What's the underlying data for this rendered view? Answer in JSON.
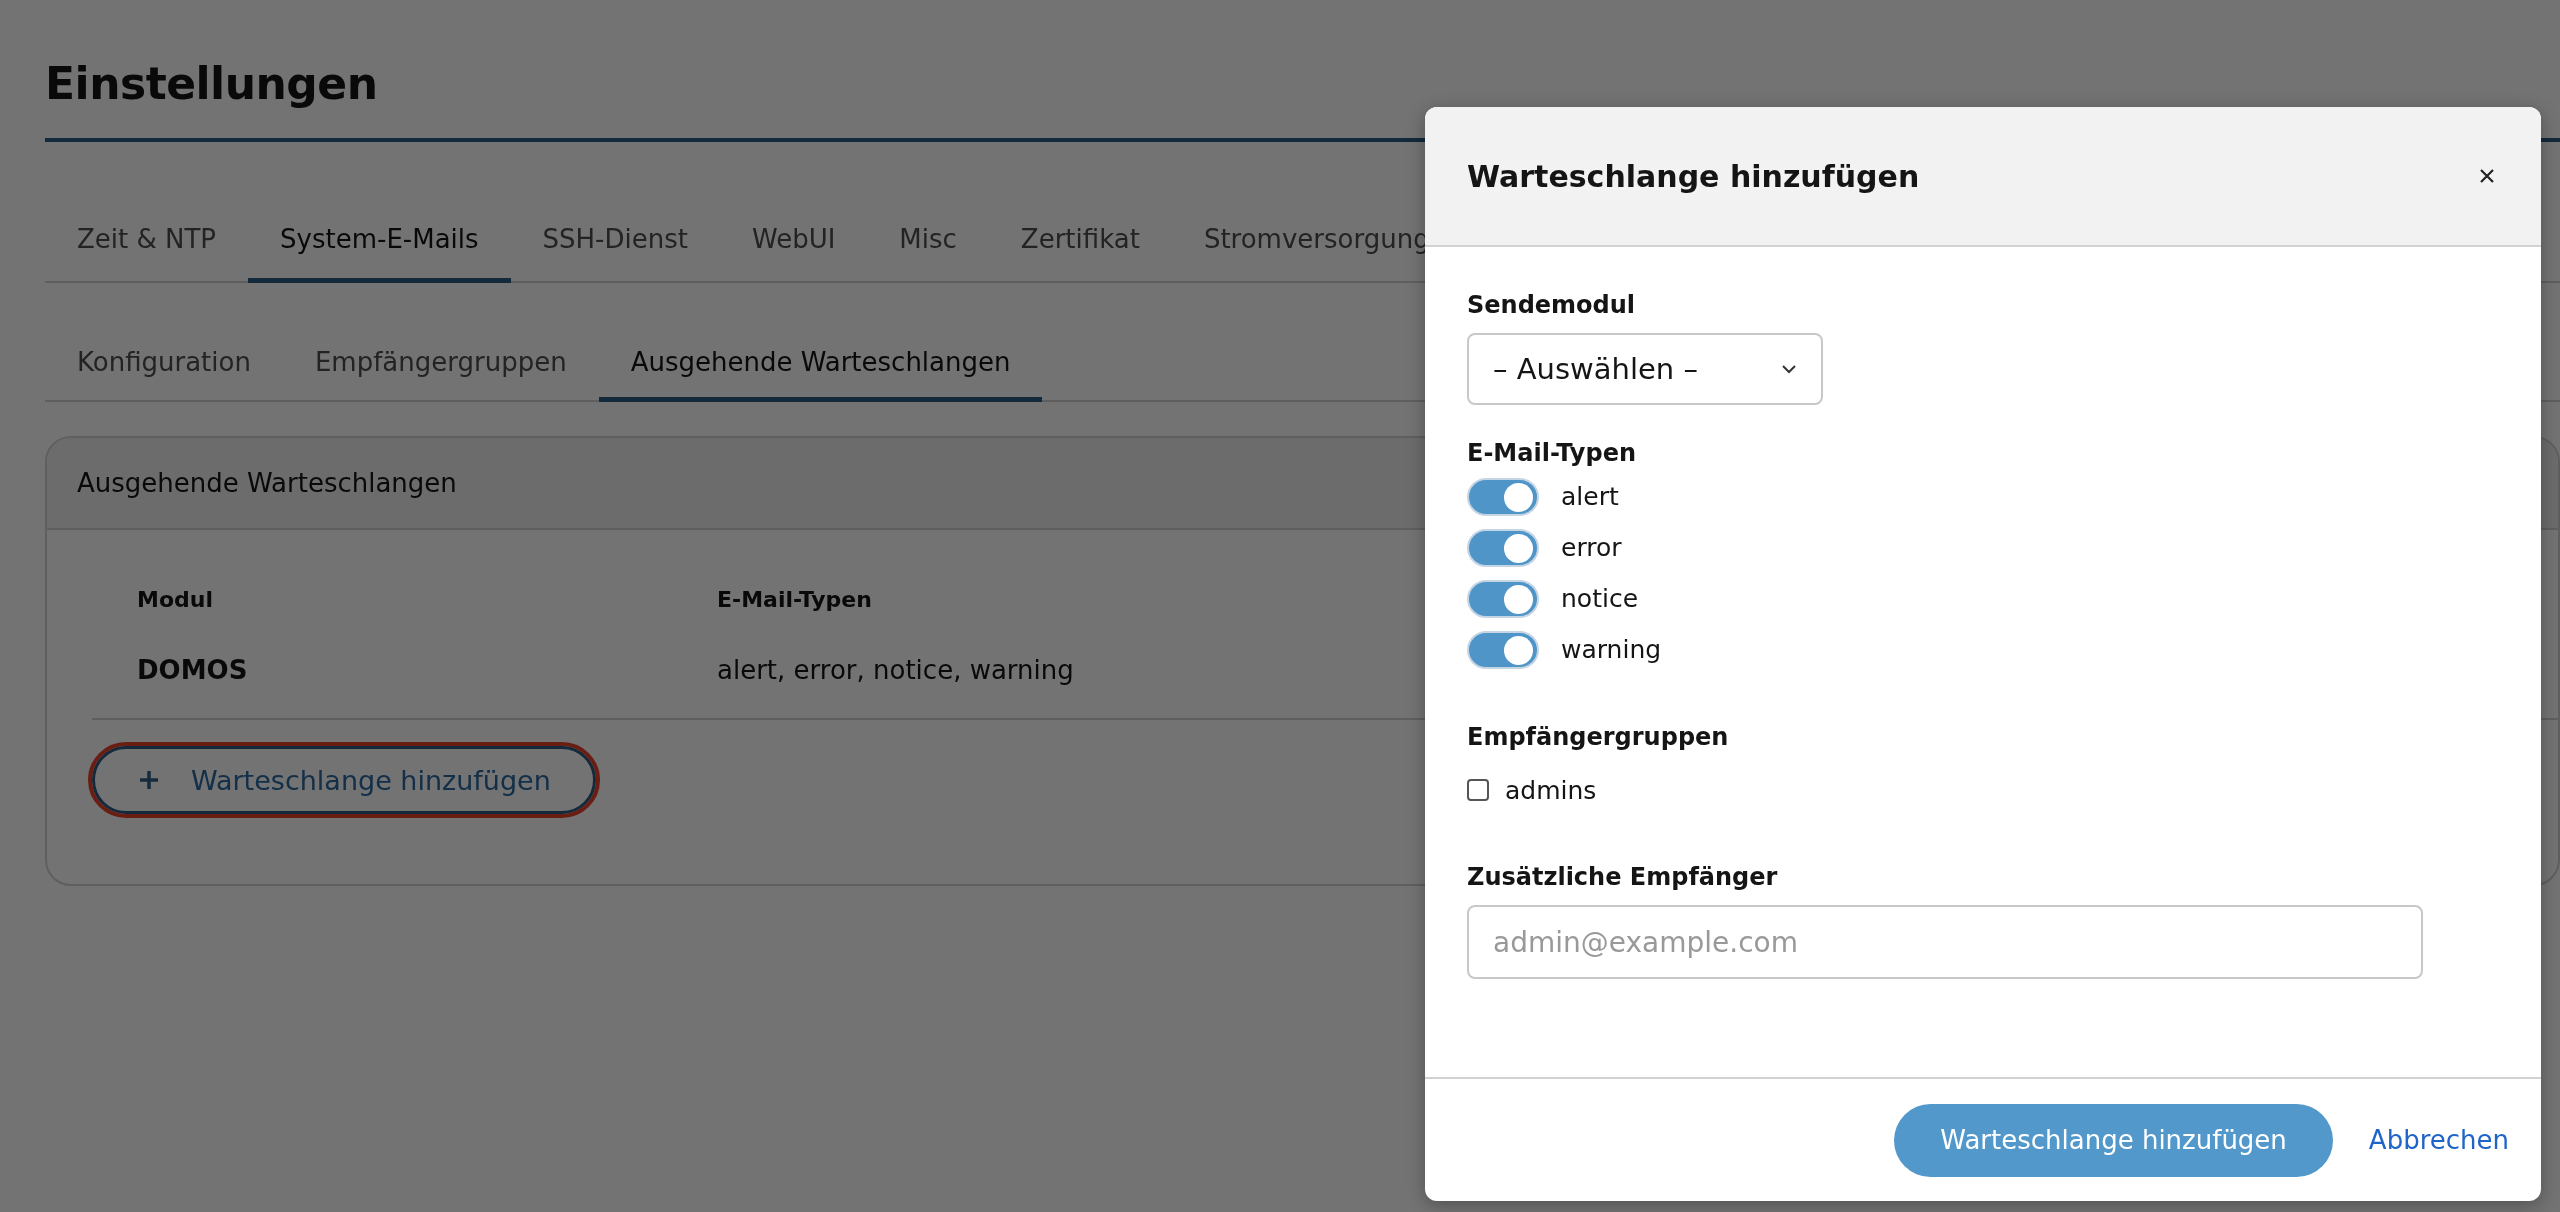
{
  "page": {
    "title": "Einstellungen",
    "tabs": [
      {
        "label": "Zeit & NTP",
        "selected": false
      },
      {
        "label": "System-E-Mails",
        "selected": true
      },
      {
        "label": "SSH-Dienst",
        "selected": false
      },
      {
        "label": "WebUI",
        "selected": false
      },
      {
        "label": "Misc",
        "selected": false
      },
      {
        "label": "Zertifikat",
        "selected": false
      },
      {
        "label": "Stromversorgung",
        "selected": false
      }
    ],
    "subtabs": [
      {
        "label": "Konfiguration",
        "selected": false
      },
      {
        "label": "Empfängergruppen",
        "selected": false
      },
      {
        "label": "Ausgehende Warteschlangen",
        "selected": true
      }
    ],
    "card": {
      "title": "Ausgehende Warteschlangen",
      "table": {
        "columns": [
          "Modul",
          "E-Mail-Typen"
        ],
        "rows": [
          [
            "DOMOS",
            "alert, error, notice, warning"
          ]
        ]
      },
      "add_button": {
        "label": "Warteschlange hinzufügen",
        "focused": true
      }
    }
  },
  "dialog": {
    "title": "Warteschlange hinzufügen",
    "sections": [
      {
        "kind": "select",
        "label": "Sendemodul",
        "value": "– Auswählen –"
      },
      {
        "kind": "toggles",
        "label": "E-Mail-Typen",
        "items": [
          {
            "label": "alert",
            "on": true
          },
          {
            "label": "error",
            "on": true
          },
          {
            "label": "notice",
            "on": true
          },
          {
            "label": "warning",
            "on": true
          }
        ]
      },
      {
        "kind": "checkboxes",
        "label": "Empfängergruppen",
        "items": [
          {
            "label": "admins",
            "checked": false
          }
        ]
      },
      {
        "kind": "input",
        "label": "Zusätzliche Empfänger",
        "placeholder": "admin@example.com"
      }
    ],
    "primary_button": "Warteschlange hinzufügen",
    "cancel_link": "Abbrechen"
  }
}
